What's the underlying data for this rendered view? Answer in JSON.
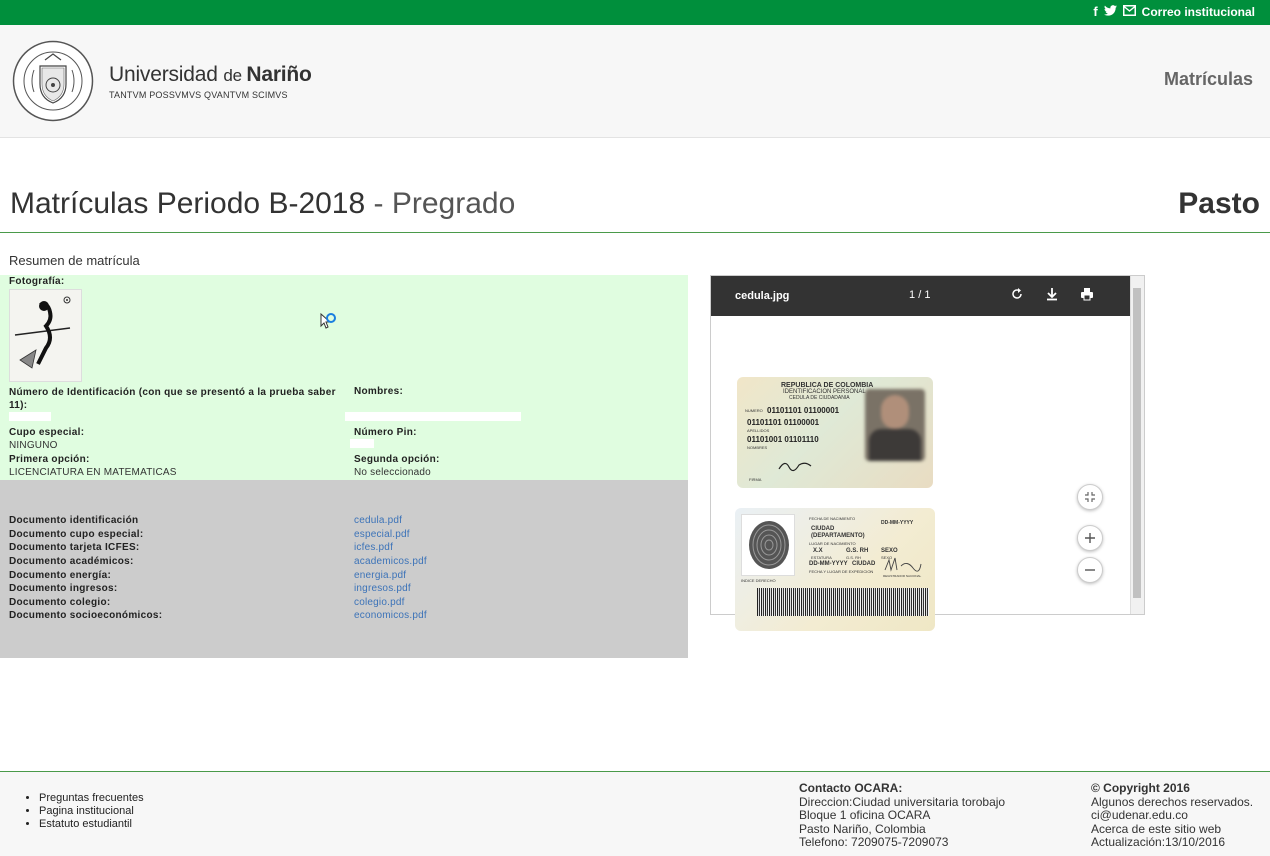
{
  "topbar": {
    "facebook_icon": "f",
    "twitter_icon": "twitter",
    "mail_label": "Correo institucional"
  },
  "header": {
    "brand_name_1": "Universidad ",
    "brand_name_de": "de ",
    "brand_name_2": "Nariño",
    "motto": "TANTVM POSSVMVS QVANTVM SCIMVS",
    "nav_item": "Matrículas",
    "seal_text_top": "TANTVM POSSVMVS QVANTVM SCIMVS",
    "seal_text_bottom": "UNIVERSIDAD DE NARIÑO"
  },
  "page": {
    "title_main": "Matrículas Periodo B-2018",
    "title_sep": " - ",
    "title_sub": "Pregrado",
    "campus": "Pasto",
    "section": "Resumen de matrícula"
  },
  "form": {
    "foto_label": "Fotografía:",
    "id_label": "Número de Identificación (con que se presentó a la prueba saber 11):",
    "nombres_label": "Nombres:",
    "cupo_label": "Cupo especial:",
    "cupo_value": "NINGUNO",
    "pin_label": "Número Pin:",
    "primera_label": "Primera opción:",
    "primera_value": "LICENCIATURA EN MATEMATICAS",
    "segunda_label": "Segunda opción:",
    "segunda_value": "No seleccionado"
  },
  "documents": [
    {
      "label": "Documento identificación",
      "file": "cedula.pdf"
    },
    {
      "label": "Documento cupo especial:",
      "file": "especial.pdf"
    },
    {
      "label": "Documento tarjeta ICFES:",
      "file": "icfes.pdf"
    },
    {
      "label": "Documento académicos:",
      "file": "academicos.pdf"
    },
    {
      "label": "Documento energía:",
      "file": "energia.pdf"
    },
    {
      "label": "Documento ingresos:",
      "file": "ingresos.pdf"
    },
    {
      "label": "Documento colegio:",
      "file": "colegio.pdf"
    },
    {
      "label": "Documento socioeconómicos:",
      "file": "economicos.pdf"
    }
  ],
  "viewer": {
    "filename": "cedula.jpg",
    "page_current": "1",
    "page_sep": "/",
    "page_total": "1",
    "card_front": {
      "country": "REPUBLICA DE COLOMBIA",
      "subtitle": "IDENTIFICACION PERSONAL",
      "doc_type": "CEDULA DE CIUDADANIA",
      "numero": "NUMERO",
      "line1": "01101101 01100001",
      "line2": "01101101 01100001",
      "apellidos": "APELLIDOS",
      "line3": "01101001 01101110",
      "nombres": "NOMBRES",
      "firma": "FIRMA"
    },
    "card_back": {
      "fecha_nac": "FECHA DE NACIMIENTO",
      "ciudad": "CIUDAD",
      "departamento": "(DEPARTAMENTO)",
      "lugar_nac": "LUGAR DE NACIMIENTO",
      "date_fmt": "DD-MM-YYYY",
      "xx": "X.X",
      "gsrh": "G.S. RH",
      "sexo": "SEXO",
      "estatura": "ESTATURA",
      "gsrh_small": "G.S. RH",
      "sexo_small": "SEXO",
      "date_fmt2": "DD-MM-YYYY",
      "ciudad2": "CIUDAD",
      "fecha_lugar": "FECHA Y LUGAR DE EXPEDICION",
      "indice": "INDICE DERECHO",
      "registrador": "REGISTRADOR NACIONAL"
    }
  },
  "footer": {
    "links": [
      "Preguntas frecuentes",
      "Pagina institucional",
      "Estatuto estudiantil"
    ],
    "contact_title": "Contacto OCARA:",
    "contact_lines": [
      "Direccion:Ciudad universitaria torobajo",
      "Bloque 1 oficina OCARA",
      "Pasto Nariño, Colombia",
      "Telefono: 7209075-7209073"
    ],
    "copyright_title": "© Copyright 2016",
    "copyright_lines": [
      "Algunos derechos reservados.",
      "ci@udenar.edu.co",
      "Acerca de este sitio web",
      "Actualización:13/10/2016"
    ]
  },
  "colors": {
    "brand_green": "#008f3c",
    "form_green_bg": "#e0fde0",
    "docs_gray_bg": "#cccccc",
    "link_blue": "#3c73b8",
    "viewer_toolbar": "#333333"
  }
}
